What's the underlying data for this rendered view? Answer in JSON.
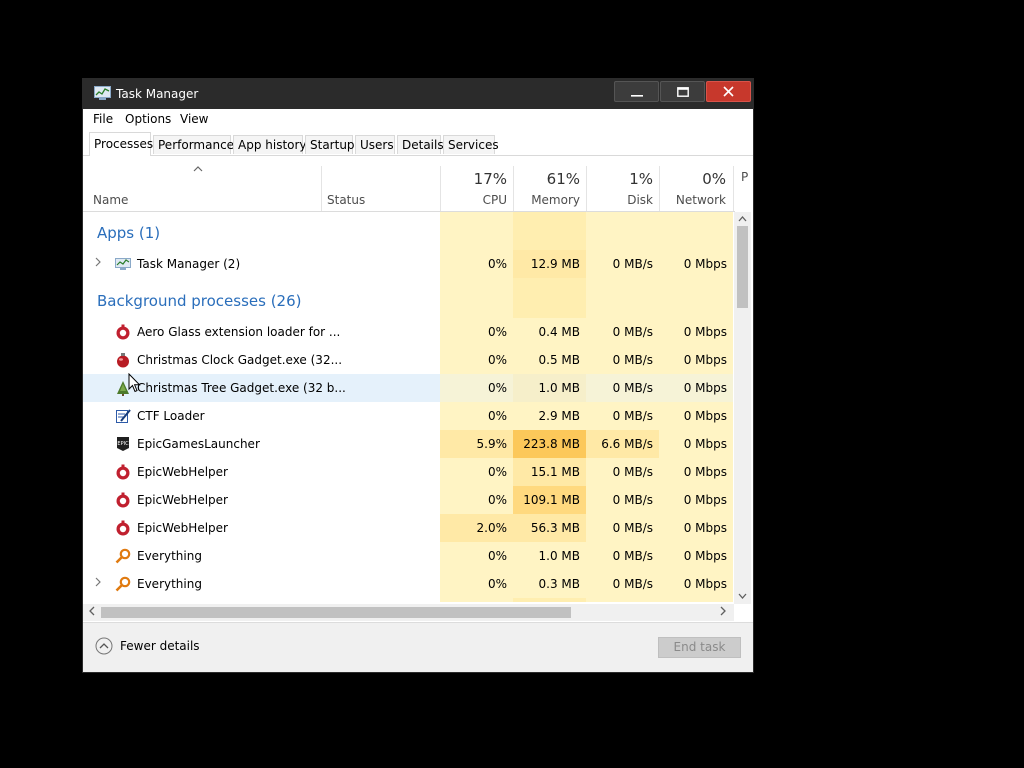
{
  "window": {
    "title": "Task Manager"
  },
  "menu": [
    "File",
    "Options",
    "View"
  ],
  "tabs": [
    {
      "label": "Processes",
      "active": true
    },
    {
      "label": "Performance"
    },
    {
      "label": "App history"
    },
    {
      "label": "Startup"
    },
    {
      "label": "Users"
    },
    {
      "label": "Details"
    },
    {
      "label": "Services"
    }
  ],
  "columns": {
    "name": "Name",
    "status": "Status",
    "cpu": {
      "pct": "17%",
      "label": "CPU"
    },
    "memory": {
      "pct": "61%",
      "label": "Memory"
    },
    "disk": {
      "pct": "1%",
      "label": "Disk"
    },
    "network": {
      "pct": "0%",
      "label": "Network"
    },
    "power_stub": "P"
  },
  "groups": [
    {
      "title": "Apps (1)",
      "rows": [
        {
          "name": "Task Manager (2)",
          "icon": "task-manager-icon",
          "expandable": true,
          "cpu": "0%",
          "memory": "12.9 MB",
          "disk": "0 MB/s",
          "network": "0 Mbps",
          "heat": [
            0,
            1,
            0,
            0
          ]
        }
      ]
    },
    {
      "title": "Background processes (26)",
      "rows": [
        {
          "name": "Aero Glass extension loader for ...",
          "icon": "aero-glass-icon",
          "cpu": "0%",
          "memory": "0.4 MB",
          "disk": "0 MB/s",
          "network": "0 Mbps",
          "heat": [
            0,
            0,
            0,
            0
          ]
        },
        {
          "name": "Christmas Clock Gadget.exe (32...",
          "icon": "ornament-icon",
          "cpu": "0%",
          "memory": "0.5 MB",
          "disk": "0 MB/s",
          "network": "0 Mbps",
          "heat": [
            0,
            0,
            0,
            0
          ]
        },
        {
          "name": "Christmas Tree Gadget.exe (32 b...",
          "icon": "tree-icon",
          "cpu": "0%",
          "memory": "1.0 MB",
          "disk": "0 MB/s",
          "network": "0 Mbps",
          "heat": [
            0,
            0,
            0,
            0
          ],
          "hover": true
        },
        {
          "name": "CTF Loader",
          "icon": "ctf-loader-icon",
          "cpu": "0%",
          "memory": "2.9 MB",
          "disk": "0 MB/s",
          "network": "0 Mbps",
          "heat": [
            0,
            0,
            0,
            0
          ]
        },
        {
          "name": "EpicGamesLauncher",
          "icon": "epic-games-icon",
          "cpu": "5.9%",
          "memory": "223.8 MB",
          "disk": "6.6 MB/s",
          "network": "0 Mbps",
          "heat": [
            1,
            3,
            1,
            0
          ]
        },
        {
          "name": "EpicWebHelper",
          "icon": "epic-web-helper-icon",
          "cpu": "0%",
          "memory": "15.1 MB",
          "disk": "0 MB/s",
          "network": "0 Mbps",
          "heat": [
            0,
            1,
            0,
            0
          ]
        },
        {
          "name": "EpicWebHelper",
          "icon": "epic-web-helper-icon",
          "cpu": "0%",
          "memory": "109.1 MB",
          "disk": "0 MB/s",
          "network": "0 Mbps",
          "heat": [
            0,
            2,
            0,
            0
          ]
        },
        {
          "name": "EpicWebHelper",
          "icon": "epic-web-helper-icon",
          "cpu": "2.0%",
          "memory": "56.3 MB",
          "disk": "0 MB/s",
          "network": "0 Mbps",
          "heat": [
            1,
            1,
            0,
            0
          ]
        },
        {
          "name": "Everything",
          "icon": "everything-search-icon",
          "cpu": "0%",
          "memory": "1.0 MB",
          "disk": "0 MB/s",
          "network": "0 Mbps",
          "heat": [
            0,
            0,
            0,
            0
          ]
        },
        {
          "name": "Everything",
          "icon": "everything-search-icon",
          "expandable": true,
          "cpu": "0%",
          "memory": "0.3 MB",
          "disk": "0 MB/s",
          "network": "0 Mbps",
          "heat": [
            0,
            0,
            0,
            0
          ]
        }
      ]
    }
  ],
  "footer": {
    "fewer_details": "Fewer details",
    "end_task": "End task"
  },
  "colors": {
    "heat0": "#fff4c4",
    "heat1": "#ffe9a6",
    "heat2": "#ffd97f",
    "heat3": "#fcc85a",
    "group_title": "#2a6ebb",
    "hover_row": "#e5f1fb"
  }
}
